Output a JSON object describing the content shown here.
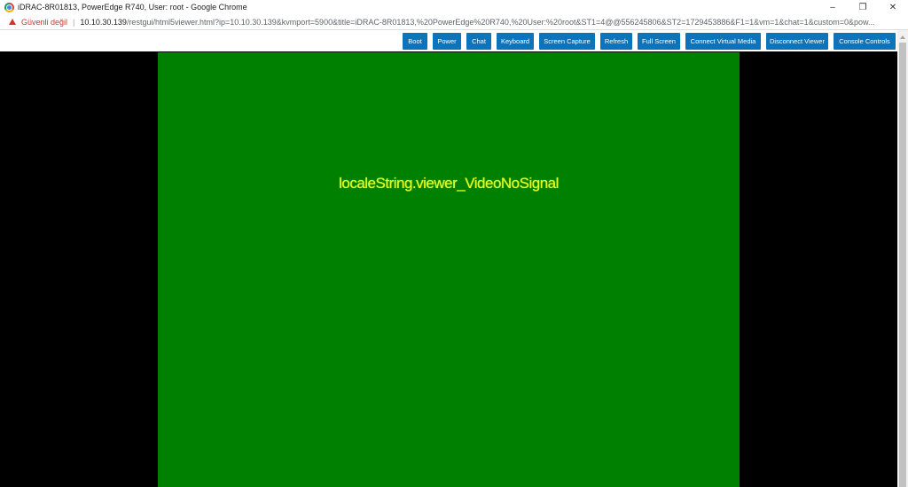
{
  "window": {
    "title": "iDRAC-8R01813, PowerEdge R740, User: root - Google Chrome",
    "controls": {
      "minimize": "–",
      "restore": "❐",
      "close": "✕"
    }
  },
  "addressbar": {
    "security_label": "Güvenli değil",
    "separator": "|",
    "url_host": "10.10.30.139",
    "url_path": "/restgui/html5viewer.html?ip=10.10.30.139&kvmport=5900&title=iDRAC-8R01813,%20PowerEdge%20R740,%20User:%20root&ST1=4@@556245806&ST2=1729453886&F1=1&vm=1&chat=1&custom=0&pow..."
  },
  "toolbar": {
    "buttons": {
      "boot": "Boot",
      "power": "Power",
      "chat": "Chat",
      "keyboard": "Keyboard",
      "screen_capture": "Screen Capture",
      "refresh": "Refresh",
      "full_screen": "Full Screen",
      "connect_virtual_media": "Connect Virtual Media",
      "disconnect_viewer": "Disconnect Viewer",
      "console_controls": "Console Controls"
    }
  },
  "viewer": {
    "message": "localeString.viewer_VideoNoSignal"
  },
  "colors": {
    "toolbar_button": "#0d74bb",
    "screen_background": "#008000",
    "message_text": "#e3ff2a",
    "security_warning": "#d93025"
  },
  "icons": [
    "chrome-icon",
    "warning-icon",
    "minimize-icon",
    "restore-icon",
    "close-icon"
  ]
}
